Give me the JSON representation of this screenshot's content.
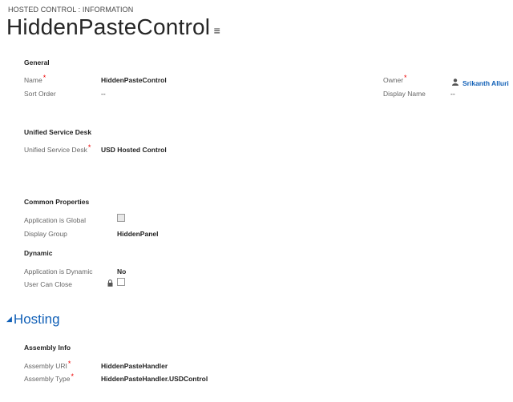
{
  "header": {
    "breadcrumb": "HOSTED CONTROL : INFORMATION",
    "title": "HiddenPasteControl",
    "menu_glyph": "≡"
  },
  "general": {
    "heading": "General",
    "name_label": "Name",
    "name_value": "HiddenPasteControl",
    "sort_order_label": "Sort Order",
    "sort_order_value": "--",
    "owner_label": "Owner",
    "owner_value": "Srikanth Alluri",
    "display_name_label": "Display Name",
    "display_name_value": "--"
  },
  "usd": {
    "heading": "Unified Service Desk",
    "field_label": "Unified Service Desk",
    "field_value": "USD Hosted Control"
  },
  "common": {
    "heading": "Common Properties",
    "app_global_label": "Application is Global",
    "app_global_checked": false,
    "display_group_label": "Display Group",
    "display_group_value": "HiddenPanel"
  },
  "dynamic": {
    "heading": "Dynamic",
    "app_dynamic_label": "Application is Dynamic",
    "app_dynamic_value": "No",
    "user_can_close_label": "User Can Close",
    "user_can_close_checked": false
  },
  "hosting": {
    "title": "Hosting",
    "assembly_heading": "Assembly Info",
    "uri_label": "Assembly URI",
    "uri_value": "HiddenPasteHandler",
    "type_label": "Assembly Type",
    "type_value": "HiddenPasteHandler.USDControl"
  },
  "required_mark": "*",
  "icons": {
    "title_menu": "list-menu-icon",
    "owner": "user-icon",
    "lock": "lock-icon",
    "collapse": "triangle-collapse-icon"
  },
  "colors": {
    "link": "#1160b7",
    "required": "#e00000"
  }
}
